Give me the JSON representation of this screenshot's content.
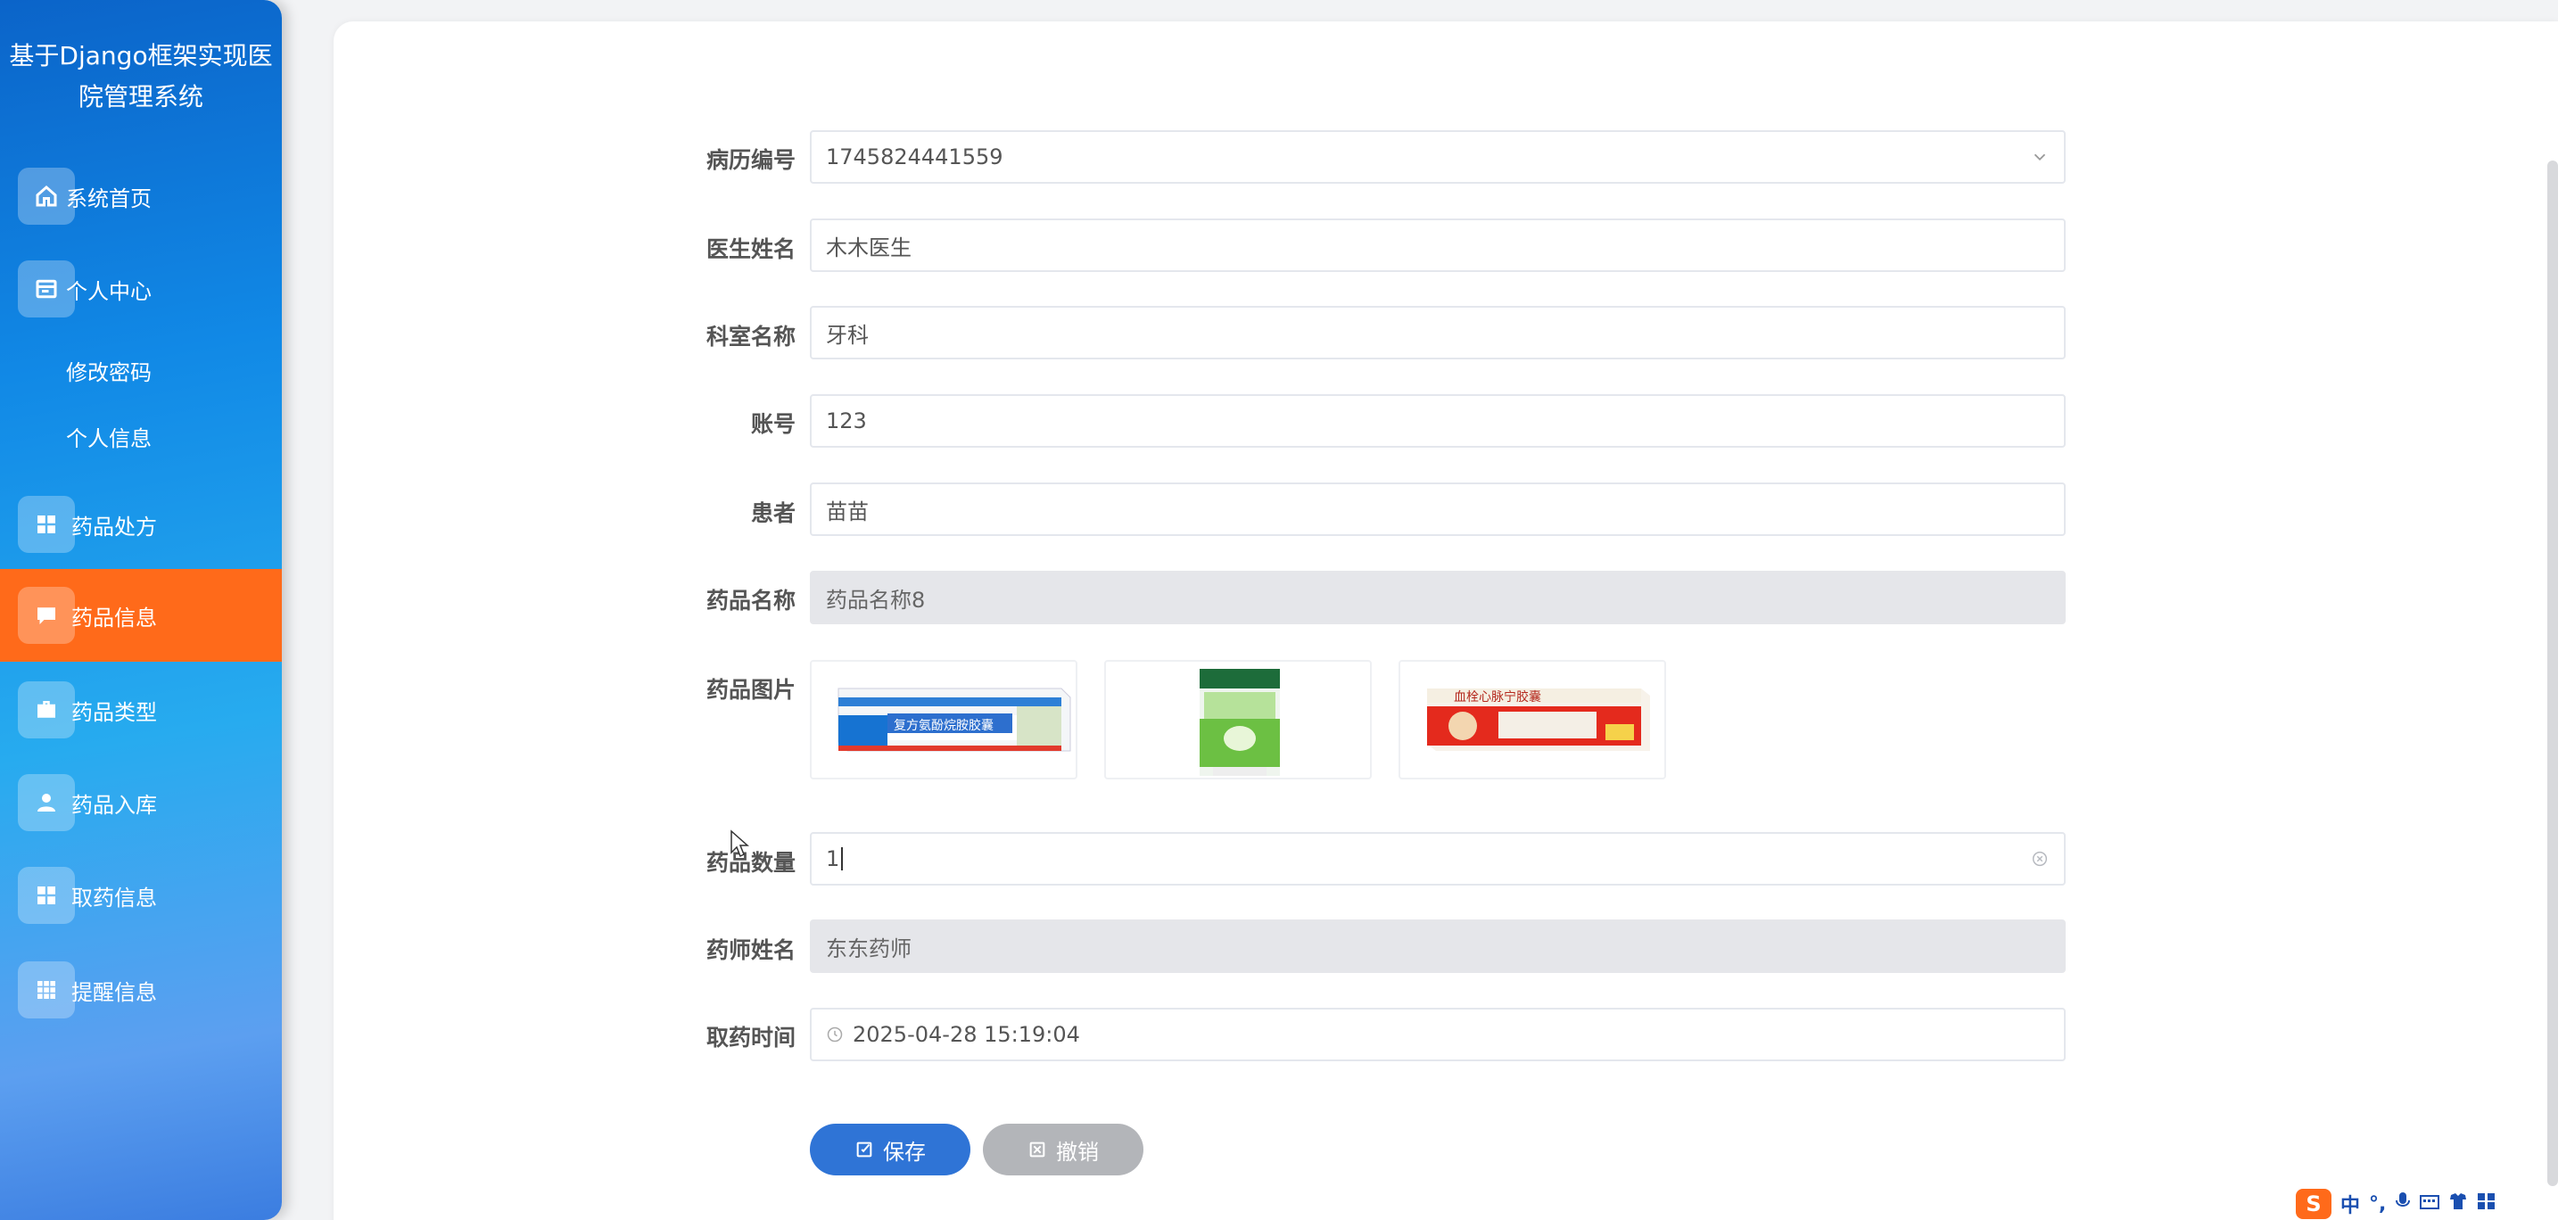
{
  "app": {
    "title": "基于Django框架实现医院管理系统"
  },
  "sidebar": {
    "items": [
      {
        "label": "系统首页",
        "icon": "home-icon"
      },
      {
        "label": "个人中心",
        "icon": "profile-card-icon"
      },
      {
        "label": "药品处方",
        "icon": "grid-icon"
      },
      {
        "label": "药品信息",
        "icon": "message-icon",
        "active": true
      },
      {
        "label": "药品类型",
        "icon": "briefcase-icon"
      },
      {
        "label": "药品入库",
        "icon": "user-icon"
      },
      {
        "label": "取药信息",
        "icon": "grid-icon"
      },
      {
        "label": "提醒信息",
        "icon": "table-icon"
      }
    ],
    "sub_items": [
      {
        "label": "修改密码"
      },
      {
        "label": "个人信息"
      }
    ]
  },
  "form": {
    "fields": [
      {
        "label": "病历编号",
        "value": "1745824441559"
      },
      {
        "label": "医生姓名",
        "value": "木木医生"
      },
      {
        "label": "科室名称",
        "value": "牙科"
      },
      {
        "label": "账号",
        "value": "123"
      },
      {
        "label": "患者",
        "value": "苗苗"
      },
      {
        "label": "药品名称",
        "value": "药品名称8"
      },
      {
        "label": "药品图片"
      },
      {
        "label": "药品数量",
        "value": "1"
      },
      {
        "label": "药师姓名",
        "value": "东东药师"
      },
      {
        "label": "取药时间",
        "value": "2025-04-28 15:19:04"
      }
    ],
    "images": [
      {
        "caption": "复方氨酚烷胺胶囊"
      },
      {
        "caption": ""
      },
      {
        "caption": "血栓心脉宁胶囊"
      }
    ],
    "buttons": {
      "save": "保存",
      "cancel": "撤销"
    }
  },
  "tray": {
    "ime": "中"
  }
}
